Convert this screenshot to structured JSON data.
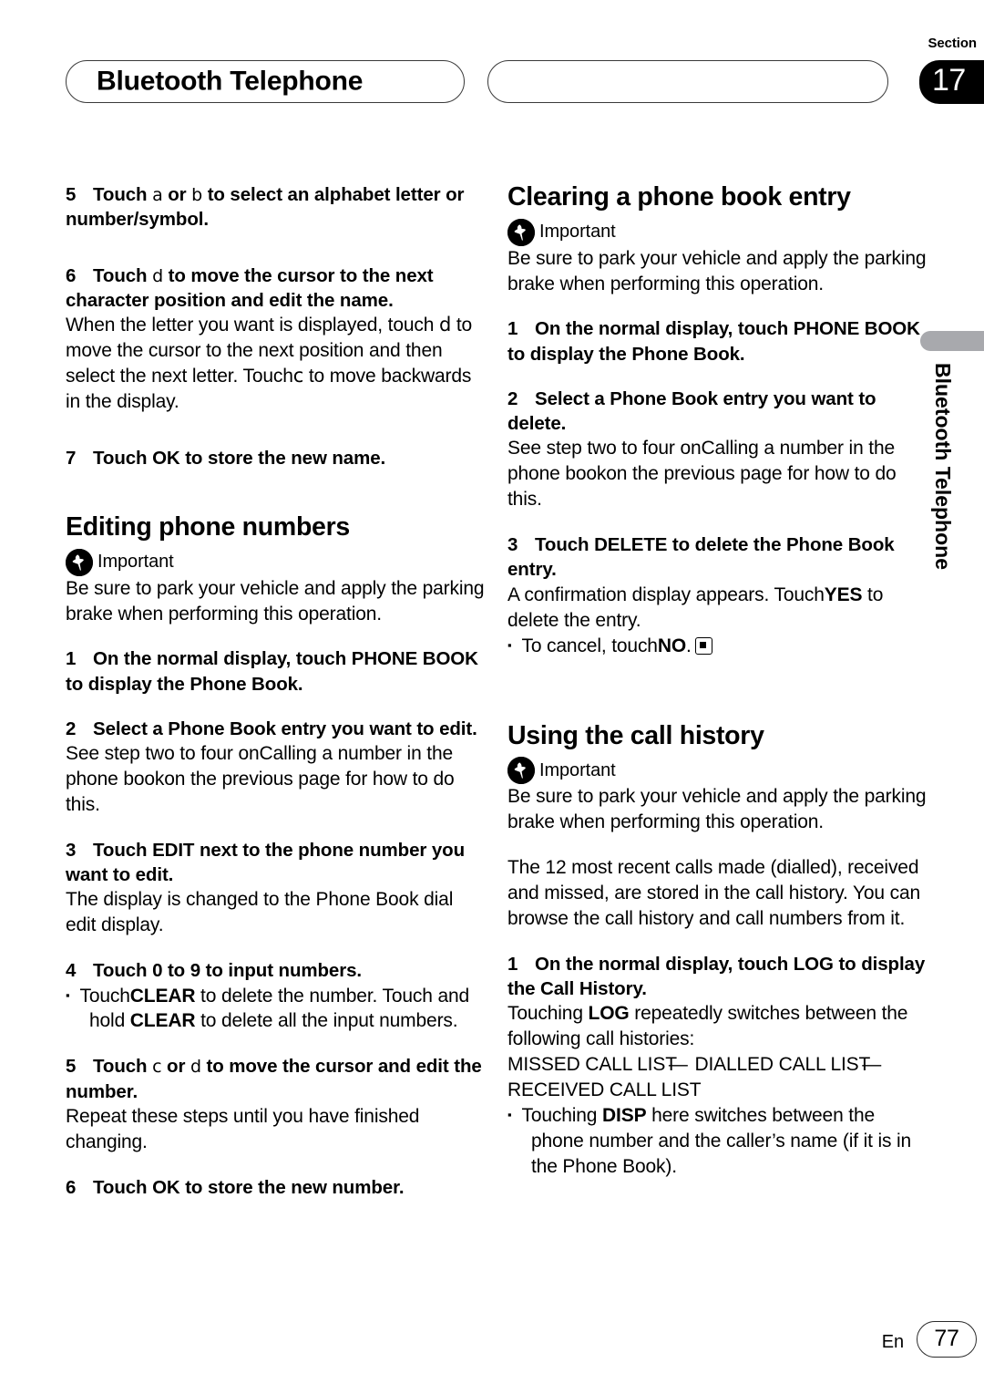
{
  "header": {
    "chapter_title": "Bluetooth Telephone",
    "section_label": "Section",
    "section_number": "17"
  },
  "side_tab": {
    "vertical_label": "Bluetooth Telephone"
  },
  "footer": {
    "language": "En",
    "page_number": "77"
  },
  "labels": {
    "important": "Important",
    "bullet": "▪"
  },
  "left_column": {
    "step5_num": "5",
    "step5_a": "Touch ",
    "step5_key1": "a",
    "step5_b": " or ",
    "step5_key2": "b",
    "step5_c": " to select an alphabet letter or number/symbol.",
    "step6_num": "6",
    "step6_a": "Touch ",
    "step6_key1": "d",
    "step6_b": " to move the cursor to the next character position and edit the name.",
    "step6_body_a": "When the letter you want is displayed, touch ",
    "step6_body_key1": "d",
    "step6_body_b": " to move the cursor to the next position and then select the next letter. Touch",
    "step6_body_key2": "c",
    "step6_body_c": " to move backwards in the display.",
    "step7_num": "7",
    "step7_text": "Touch OK to store the new name.",
    "heading_editing": "Editing phone numbers",
    "important_body": "Be sure to park your vehicle and apply the parking brake when performing this operation.",
    "e_step1_num": "1",
    "e_step1_text": "On the normal display, touch PHONE BOOK to display the Phone Book.",
    "e_step2_num": "2",
    "e_step2_text": "Select a Phone Book entry you want to edit.",
    "e_step2_body": "See step two to four onCalling a number in the phone bookon the previous page for how to do this.",
    "e_step3_num": "3",
    "e_step3_text": "Touch EDIT next to the phone number you want to edit.",
    "e_step3_body": "The display is changed to the Phone Book dial edit display.",
    "e_step4_num": "4",
    "e_step4_text": "Touch 0 to 9 to input numbers.",
    "e_step4_bullet_a": "Touch",
    "e_step4_bullet_b": "CLEAR",
    "e_step4_bullet_c": " to delete the number. Touch and hold ",
    "e_step4_bullet_d": "CLEAR",
    "e_step4_bullet_e": " to delete all the input numbers.",
    "e_step5_num": "5",
    "e_step5_a": "Touch ",
    "e_step5_key1": "c",
    "e_step5_b": " or ",
    "e_step5_key2": "d",
    "e_step5_c": " to move the cursor and edit the number.",
    "e_step5_body": "Repeat these steps until you have finished changing.",
    "e_step6_num": "6",
    "e_step6_text": "Touch OK to store the new number."
  },
  "right_column": {
    "heading_clearing": "Clearing a phone book entry",
    "important_body": "Be sure to park your vehicle and apply the parking brake when performing this operation.",
    "c_step1_num": "1",
    "c_step1_text": "On the normal display, touch PHONE BOOK to display the Phone Book.",
    "c_step2_num": "2",
    "c_step2_text": "Select a Phone Book entry you want to delete.",
    "c_step2_body": "See step two to four onCalling a number in the phone bookon the previous page for how to do this.",
    "c_step3_num": "3",
    "c_step3_text": "Touch DELETE to delete the Phone Book entry.",
    "c_step3_body_a": "A confirmation display appears. Touch",
    "c_step3_body_yes": "YES",
    "c_step3_body_b": " to delete the entry.",
    "c_bullet_a": "To cancel, touch",
    "c_bullet_no": "NO",
    "c_bullet_b": ".",
    "heading_call_history": "Using the call history",
    "ch_important_body": "Be sure to park your vehicle and apply the parking brake when performing this operation.",
    "ch_intro": "The 12 most recent calls made (dialled), received and missed, are stored in the call history. You can browse the call history and call numbers from it.",
    "ch_step1_num": "1",
    "ch_step1_text": "On the normal display, touch LOG to display the Call History.",
    "ch_step1_body_a": "Touching ",
    "ch_step1_body_log": "LOG",
    "ch_step1_body_b": " repeatedly switches between the following call histories:",
    "ch_list_1": "MISSED CALL LIST",
    "ch_list_sep": "—",
    "ch_list_2": "DIALLED CALL LIST",
    "ch_list_3": "RECEIVED CALL LIST",
    "ch_bullet_a": "Touching ",
    "ch_bullet_disp": "DISP",
    "ch_bullet_b": " here switches between the phone number and the caller’s name (if it is in the Phone Book)."
  }
}
